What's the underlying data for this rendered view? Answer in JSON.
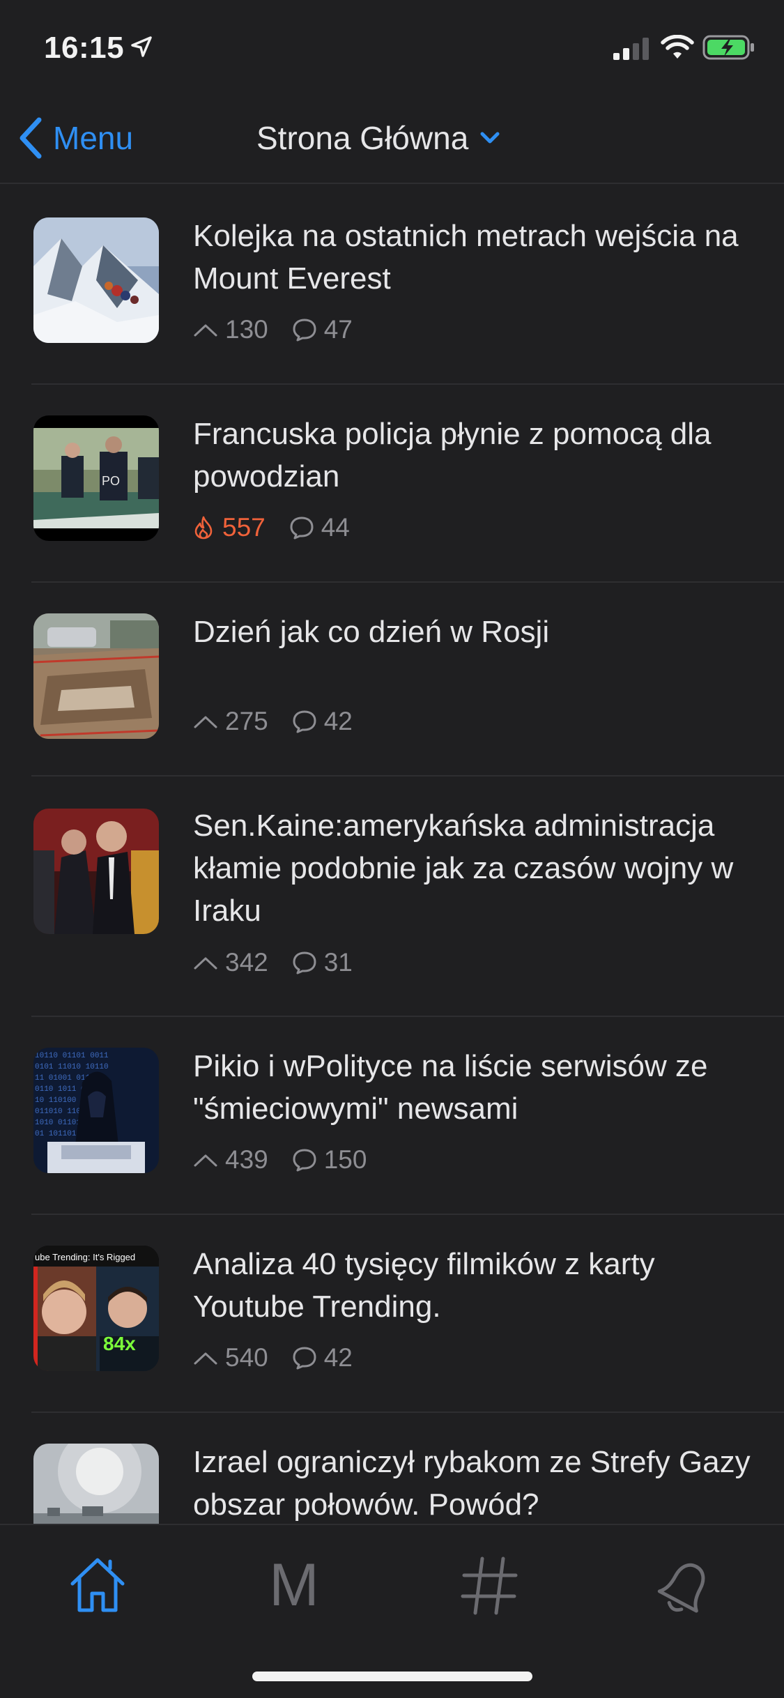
{
  "status_bar": {
    "time": "16:15"
  },
  "nav": {
    "back_label": "Menu",
    "title": "Strona Główna"
  },
  "accent_color": "#2f8ff3",
  "hot_color": "#f0623a",
  "feed": [
    {
      "title": "Kolejka na ostatnich metrach wejścia na Mount Everest",
      "votes": "130",
      "comments": "47",
      "hot": false
    },
    {
      "title": "Francuska policja płynie z pomocą dla powodzian",
      "votes": "557",
      "comments": "44",
      "hot": true
    },
    {
      "title": "Dzień jak co dzień w Rosji",
      "votes": "275",
      "comments": "42",
      "hot": false
    },
    {
      "title": "Sen.Kaine:amerykańska administracja kłamie podobnie jak za czasów wojny w Iraku",
      "votes": "342",
      "comments": "31",
      "hot": false
    },
    {
      "title": "Pikio i wPolityce na liście serwisów ze \"śmieciowymi\" newsami",
      "votes": "439",
      "comments": "150",
      "hot": false
    },
    {
      "title": "Analiza 40 tysięcy filmików z karty Youtube Trending.",
      "votes": "540",
      "comments": "42",
      "hot": false,
      "thumb_text_top": "ube Trending: It's Rigged",
      "thumb_text_badge": "84x"
    },
    {
      "title": "Izrael ograniczył rybakom ze Strefy Gazy obszar połowów. Powód?",
      "votes": "",
      "comments": "",
      "hot": false
    }
  ],
  "tabs": [
    {
      "icon": "home-icon",
      "active": true
    },
    {
      "icon": "m-letter-icon",
      "label": "M",
      "active": false
    },
    {
      "icon": "hashtag-icon",
      "active": false
    },
    {
      "icon": "bell-icon",
      "active": false
    }
  ]
}
